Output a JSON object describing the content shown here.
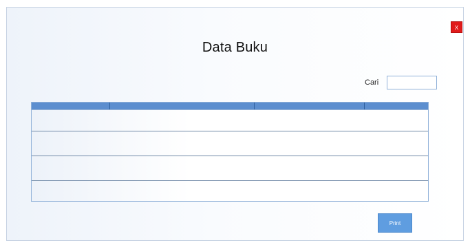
{
  "window": {
    "title": "Data Buku",
    "close_label": "X"
  },
  "search": {
    "label": "Cari",
    "value": "",
    "placeholder": ""
  },
  "table": {
    "headers": [
      "",
      "",
      "",
      ""
    ],
    "rows": [
      [
        "",
        "",
        "",
        ""
      ],
      [
        "",
        "",
        "",
        ""
      ],
      [
        "",
        "",
        "",
        ""
      ],
      [
        "",
        "",
        "",
        ""
      ]
    ]
  },
  "actions": {
    "print_label": "Print"
  },
  "colors": {
    "accent": "#5c8ecf",
    "close": "#e11b1b",
    "button": "#5f9de0"
  }
}
